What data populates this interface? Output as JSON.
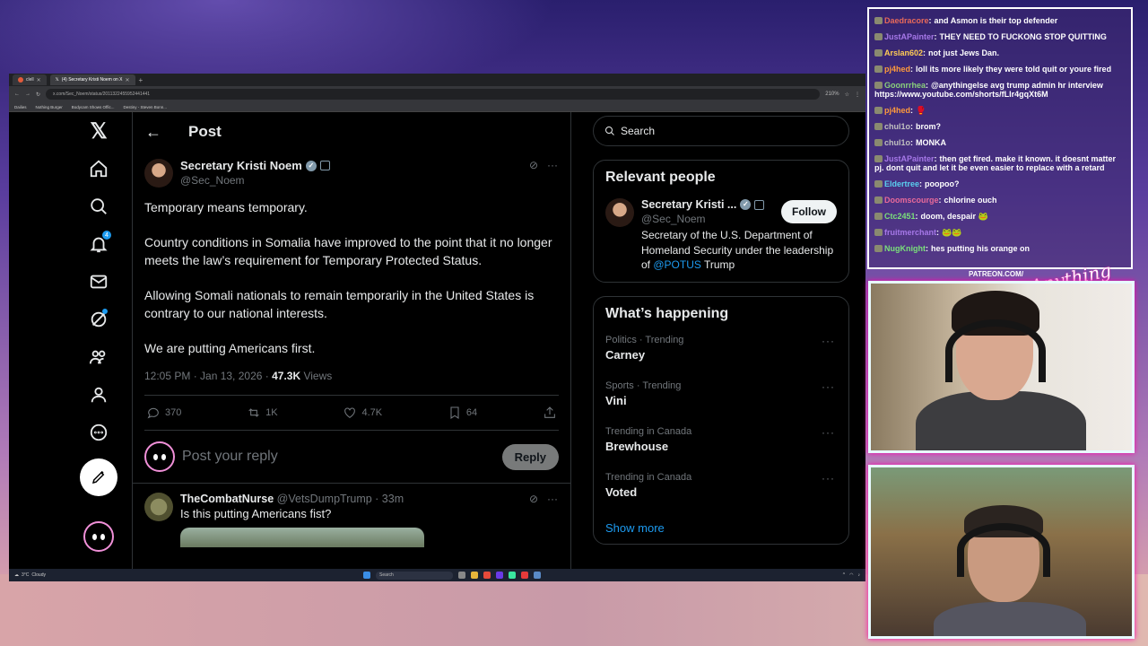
{
  "browser": {
    "tabs": [
      {
        "label": "clell",
        "active": false
      },
      {
        "label": "(4) Secretary Kristi Noem on X",
        "active": true
      }
    ],
    "url": "x.com/Sec_Noem/status/2011322455952441441",
    "zoom": "210%",
    "bookmarks": [
      "Dailies",
      "Nothing Burger",
      "Bodycam Shows Offic...",
      "Destiny - Steven Bonn..."
    ]
  },
  "x": {
    "nav": {
      "notifications_badge": "4"
    },
    "header": {
      "title": "Post"
    },
    "tweet": {
      "author_name": "Secretary Kristi Noem",
      "author_handle": "@Sec_Noem",
      "paragraphs": [
        "Temporary means temporary.",
        "Country conditions in Somalia have improved to the point that it no longer meets the law’s requirement for Temporary Protected Status.",
        "Allowing Somali nationals to remain temporarily in the United States is contrary to our national interests.",
        "We are putting Americans first."
      ],
      "time": "12:05 PM · Jan 13, 2026 ·",
      "views_count": "47.3K",
      "views_label": "Views",
      "replies": "370",
      "reposts": "1K",
      "likes": "4.7K",
      "bookmarks": "64"
    },
    "reply_box": {
      "placeholder": "Post your reply",
      "button": "Reply"
    },
    "first_reply": {
      "name": "TheCombatNurse",
      "handle": "@VetsDumpTrump · 33m",
      "text": "Is this putting Americans fist?"
    },
    "search_placeholder": "Search",
    "relevant": {
      "title": "Relevant people",
      "name": "Secretary Kristi ...",
      "handle": "@Sec_Noem",
      "follow": "Follow",
      "bio_pre": "Secretary of the U.S. Department of Homeland Security under the leadership of ",
      "bio_link": "@POTUS",
      "bio_post": " Trump"
    },
    "happening": {
      "title": "What’s happening",
      "trends": [
        {
          "category": "Politics · Trending",
          "name": "Carney"
        },
        {
          "category": "Sports · Trending",
          "name": "Vini"
        },
        {
          "category": "Trending in Canada",
          "name": "Brewhouse"
        },
        {
          "category": "Trending in Canada",
          "name": "Voted"
        }
      ],
      "show_more": "Show more"
    }
  },
  "taskbar": {
    "temp": "3°C",
    "weather": "Cloudy",
    "search": "Search"
  },
  "chat": [
    {
      "user": "Daedracore",
      "color": "#e86a5a",
      "text": "and Asmon is their top defender"
    },
    {
      "user": "JustAPainter",
      "color": "#a678e8",
      "text": "THEY NEED TO FUCKONG STOP QUITTING"
    },
    {
      "user": "Arslan602",
      "color": "#ffcc55",
      "text": "not just Jews Dan."
    },
    {
      "user": "pj4hed",
      "color": "#ff9a3c",
      "text": "loll its more likely they were told quit or youre fired"
    },
    {
      "user": "Goonrrhea",
      "color": "#8ad07a",
      "text": "@anythingelse avg trump admin hr interview https://www.youtube.com/shorts/fLlr4gqXt6M"
    },
    {
      "user": "pj4hed",
      "color": "#ff9a3c",
      "text": "🥊"
    },
    {
      "user": "chul1o",
      "color": "#c0c0c0",
      "text": "brom?"
    },
    {
      "user": "chul1o",
      "color": "#c0c0c0",
      "text": "MONKA"
    },
    {
      "user": "JustAPainter",
      "color": "#a678e8",
      "text": "then get fired. make it known. it doesnt matter pj. dont quit and let it be even easier to replace with a retard"
    },
    {
      "user": "Eldertree",
      "color": "#5ad0f0",
      "text": "poopoo?"
    },
    {
      "user": "Doomscourge",
      "color": "#e86a9a",
      "text": "chlorine ouch"
    },
    {
      "user": "Ctc2451",
      "color": "#7ae07a",
      "text": "doom, despair 🐸"
    },
    {
      "user": "fruitmerchant",
      "color": "#a678e8",
      "text": "🐸🐸"
    },
    {
      "user": "NugKnight",
      "color": "#7ae07a",
      "text": "hes putting his orange on"
    }
  ],
  "overlay": {
    "patreon": "PATREON.COM/",
    "logo": "Anything Else?"
  }
}
